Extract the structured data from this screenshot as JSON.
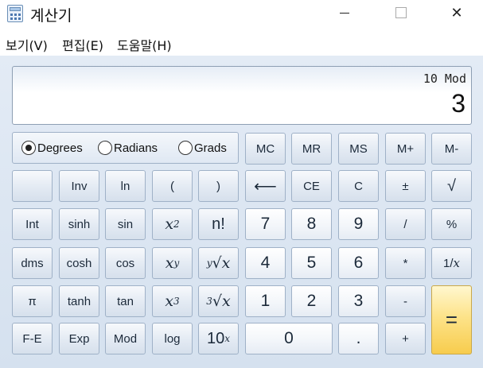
{
  "window": {
    "title": "계산기",
    "controls": {
      "minimize": "─",
      "close": "✕"
    }
  },
  "menu": {
    "items": [
      {
        "label": "보기(V)"
      },
      {
        "label": "편집(E)"
      },
      {
        "label": "도움말(H)"
      }
    ]
  },
  "display": {
    "expression": "10 Mod",
    "value": "3"
  },
  "angle_mode": {
    "options": [
      {
        "label": "Degrees",
        "selected": true
      },
      {
        "label": "Radians",
        "selected": false
      },
      {
        "label": "Grads",
        "selected": false
      }
    ]
  },
  "memory": {
    "mc": "MC",
    "mr": "MR",
    "ms": "MS",
    "mplus": "M+",
    "mminus": "M-"
  },
  "keys": {
    "inv": "Inv",
    "ln": "ln",
    "lparen": "(",
    "rparen": ")",
    "backspace": "⟵",
    "ce": "CE",
    "c": "C",
    "plusminus": "±",
    "sqrt": "√",
    "int": "Int",
    "sinh": "sinh",
    "sin": "sin",
    "x_base": "x",
    "square_exp": "2",
    "fact": "n!",
    "seven": "7",
    "eight": "8",
    "nine": "9",
    "divide": "/",
    "percent": "%",
    "dms": "dms",
    "cosh": "cosh",
    "cos": "cos",
    "pow_exp": "y",
    "yroot_index": "y",
    "root_sign": "√",
    "four": "4",
    "five": "5",
    "six": "6",
    "multiply": "*",
    "reciprocal_prefix": "1/",
    "pi": "π",
    "tanh": "tanh",
    "tan": "tan",
    "cube_exp": "3",
    "cuberoot_index": "3",
    "one": "1",
    "two": "2",
    "three": "3",
    "minus": "-",
    "equals": "=",
    "fe": "F-E",
    "exp": "Exp",
    "mod": "Mod",
    "log": "log",
    "ten_base": "10",
    "zero": "0",
    "decimal": ".",
    "plus": "+"
  },
  "colors": {
    "background": "#dbe5f1",
    "equals_button": "#fde38a",
    "button_border": "#9fb1c7"
  }
}
